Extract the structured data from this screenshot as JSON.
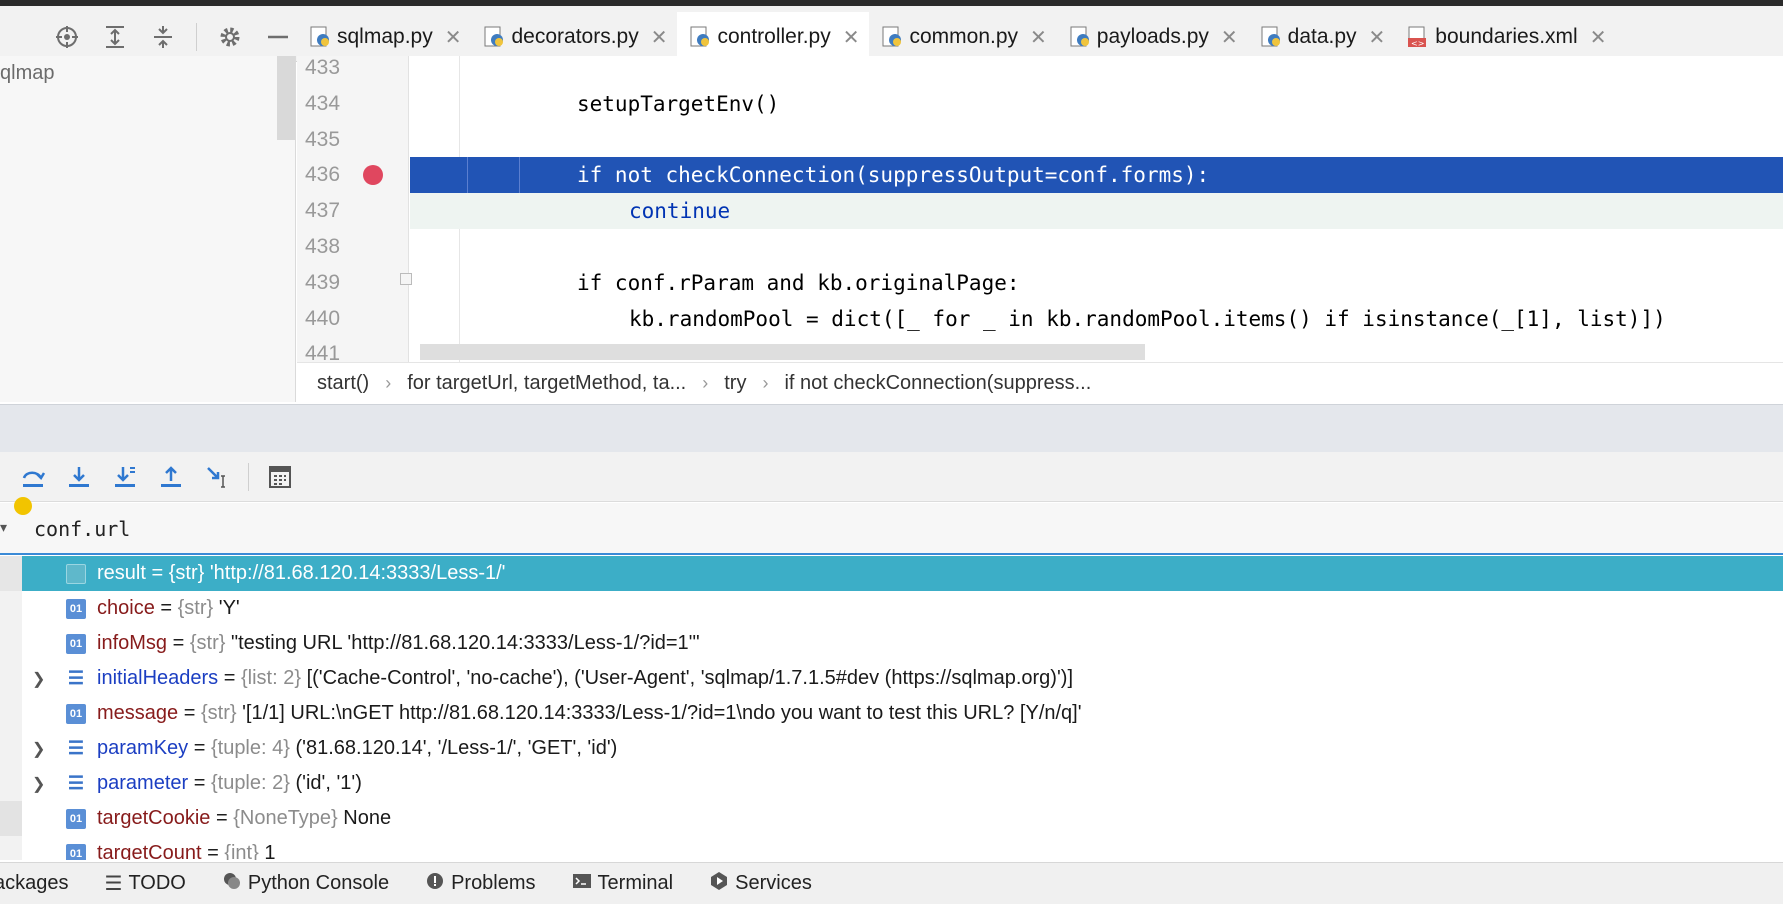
{
  "tabs": [
    {
      "label": "sqlmap.py",
      "icon": "python-file-icon",
      "active": false
    },
    {
      "label": "decorators.py",
      "icon": "python-file-icon",
      "active": false
    },
    {
      "label": "controller.py",
      "icon": "python-file-icon",
      "active": true
    },
    {
      "label": "common.py",
      "icon": "python-file-icon",
      "active": false
    },
    {
      "label": "payloads.py",
      "icon": "python-file-icon",
      "active": false
    },
    {
      "label": "data.py",
      "icon": "python-file-icon",
      "active": false
    },
    {
      "label": "boundaries.xml",
      "icon": "xml-file-icon",
      "active": false
    }
  ],
  "project": {
    "root_label": "qlmap"
  },
  "editor": {
    "lines": [
      {
        "num": "433",
        "text": ""
      },
      {
        "num": "434",
        "text": "setupTargetEnv()"
      },
      {
        "num": "435",
        "text": ""
      },
      {
        "num": "436",
        "text": "if not checkConnection(suppressOutput=conf.forms):"
      },
      {
        "num": "437",
        "text": "continue"
      },
      {
        "num": "438",
        "text": ""
      },
      {
        "num": "439",
        "text": "if conf.rParam and kb.originalPage:"
      },
      {
        "num": "440",
        "text": "kb.randomPool = dict([_ for _ in kb.randomPool.items() if isinstance(_[1], list)])"
      },
      {
        "num": "441",
        "text": ""
      }
    ]
  },
  "breadcrumbs": [
    "start()",
    "for targetUrl, targetMethod, ta...",
    "try",
    "if not checkConnection(suppress..."
  ],
  "watch": {
    "expression": "conf.url"
  },
  "variables": [
    {
      "name": "result",
      "type": "{str}",
      "value": "'http://81.68.120.14:3333/Less-1/'",
      "icon": "calculator-icon"
    },
    {
      "name": "choice",
      "type": "{str}",
      "value": "'Y'",
      "icon": "o1-icon"
    },
    {
      "name": "infoMsg",
      "type": "{str}",
      "value": "\"testing URL 'http://81.68.120.14:3333/Less-1/?id=1'\"",
      "icon": "o1-icon"
    },
    {
      "name": "initialHeaders",
      "type": "{list: 2}",
      "value": "[('Cache-Control', 'no-cache'), ('User-Agent', 'sqlmap/1.7.1.5#dev (https://sqlmap.org)')]",
      "icon": "list-icon"
    },
    {
      "name": "message",
      "type": "{str}",
      "value": "'[1/1] URL:\\nGET http://81.68.120.14:3333/Less-1/?id=1\\ndo you want to test this URL? [Y/n/q]'",
      "icon": "o1-icon"
    },
    {
      "name": "paramKey",
      "type": "{tuple: 4}",
      "value": "('81.68.120.14', '/Less-1/', 'GET', 'id')",
      "icon": "list-icon"
    },
    {
      "name": "parameter",
      "type": "{tuple: 2}",
      "value": "('id', '1')",
      "icon": "list-icon"
    },
    {
      "name": "targetCookie",
      "type": "{NoneType}",
      "value": "None",
      "icon": "o1-icon"
    },
    {
      "name": "targetCount",
      "type": "{int}",
      "value": "1",
      "icon": "o1-icon"
    }
  ],
  "bottom_tabs": [
    {
      "label": "ackages",
      "icon": ""
    },
    {
      "label": "TODO",
      "icon": "list-icon"
    },
    {
      "label": "Python Console",
      "icon": "python-icon"
    },
    {
      "label": "Problems",
      "icon": "warning-icon"
    },
    {
      "label": "Terminal",
      "icon": "terminal-icon"
    },
    {
      "label": "Services",
      "icon": "services-icon"
    }
  ],
  "colors": {
    "accent": "#2154b5",
    "selected_row": "#3caec7",
    "breakpoint": "#e0475f"
  }
}
